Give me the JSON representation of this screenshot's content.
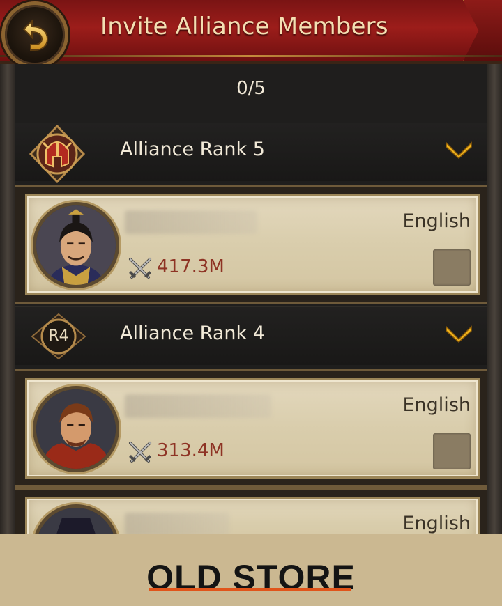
{
  "header": {
    "title": "Invite Alliance Members",
    "back_icon": "back-arrow-icon"
  },
  "selection_count": "0/5",
  "ranks": [
    {
      "label": "Alliance Rank 5",
      "emblem_icon": "helmet-emblem-icon",
      "members": [
        {
          "power": "417.3M",
          "language": "English",
          "selected": false,
          "avatar": "warrior-black-hair"
        }
      ]
    },
    {
      "label": "Alliance Rank 4",
      "badge_text": "R4",
      "members": [
        {
          "power": "313.4M",
          "language": "English",
          "selected": false,
          "avatar": "warrior-red-cape"
        },
        {
          "power": "",
          "language": "English",
          "selected": false,
          "avatar": "warrior-hat"
        }
      ]
    }
  ],
  "footer": {
    "text": "OLD STORE"
  },
  "colors": {
    "header_red": "#9c1d1a",
    "title_gold": "#f4dfb2",
    "power_red": "#8e3324",
    "card_parchment": "#d9cdac",
    "chevron_gold": "#f0b41c"
  }
}
